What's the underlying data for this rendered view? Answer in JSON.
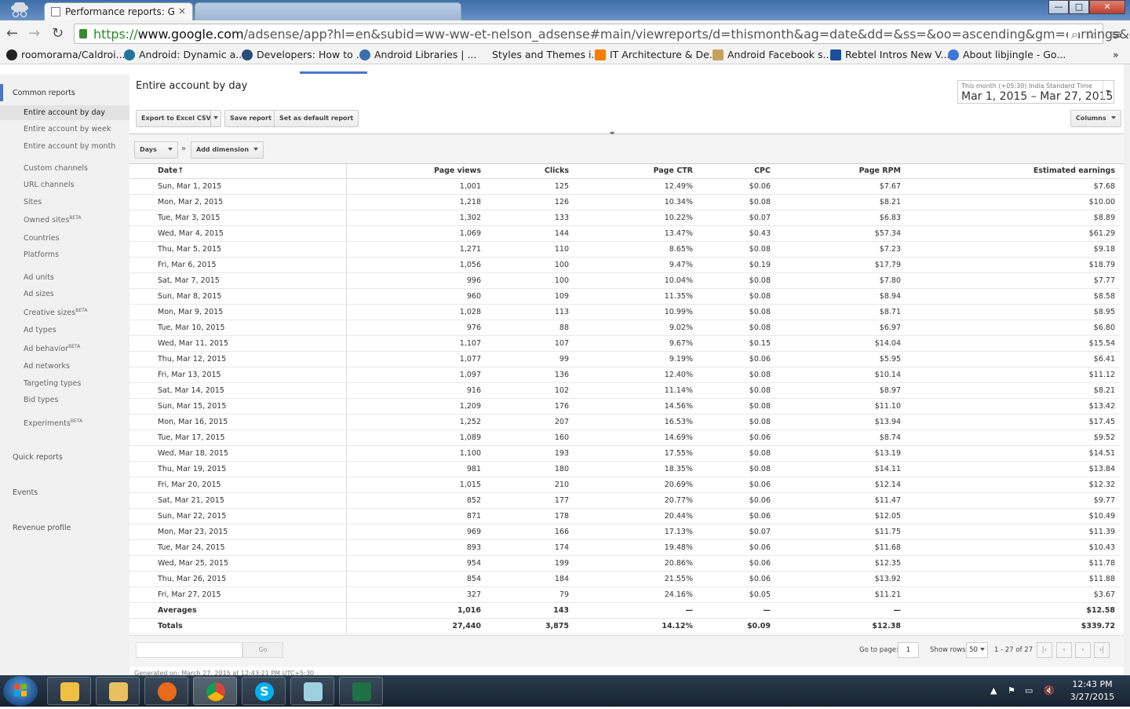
{
  "browser": {
    "active_tab_title": "Performance reports: Goo",
    "url_scheme": "https://",
    "url_host": "www.google.com",
    "url_path": "/adsense/app?hl=en&subid=ww-ww-et-nelson_adsense#main/viewreports/d=thismonth&ag=date&dd=&ss=&oo=ascending&gm=earnings&co=d&",
    "tab_close": "×",
    "win_min": "—",
    "win_max": "□",
    "win_close": "✕"
  },
  "bookmarks": [
    {
      "label": "roomorama/Caldroi...",
      "color": "#222222"
    },
    {
      "label": "Android: Dynamic a...",
      "color": "#21759b"
    },
    {
      "label": "Developers: How to ...",
      "color": "#2a4d7a"
    },
    {
      "label": "Android Libraries | ...",
      "color": "#3a6fb0"
    },
    {
      "label": "Styles and Themes i...",
      "color": "#f3f3f3"
    },
    {
      "label": "IT Architecture & De...",
      "color": "#f57d00"
    },
    {
      "label": "Android Facebook s...",
      "color": "#c8a060"
    },
    {
      "label": "Rebtel Intros New V...",
      "color": "#1a4f9a"
    },
    {
      "label": "About libjingle - Go...",
      "color": "#3c78d8"
    }
  ],
  "bookmarks_more": "»",
  "sidebar": {
    "heading_common": "Common reports",
    "common": [
      "Entire account by day",
      "Entire account by week",
      "Entire account by month"
    ],
    "group2": [
      {
        "label": "Custom channels",
        "sup": ""
      },
      {
        "label": "URL channels",
        "sup": ""
      },
      {
        "label": "Sites",
        "sup": ""
      },
      {
        "label": "Owned sites",
        "sup": "BETA"
      },
      {
        "label": "Countries",
        "sup": ""
      },
      {
        "label": "Platforms",
        "sup": ""
      }
    ],
    "group3": [
      {
        "label": "Ad units",
        "sup": ""
      },
      {
        "label": "Ad sizes",
        "sup": ""
      },
      {
        "label": "Creative sizes",
        "sup": "BETA"
      },
      {
        "label": "Ad types",
        "sup": ""
      },
      {
        "label": "Ad behavior",
        "sup": "BETA"
      },
      {
        "label": "Ad networks",
        "sup": ""
      },
      {
        "label": "Targeting types",
        "sup": ""
      },
      {
        "label": "Bid types",
        "sup": ""
      }
    ],
    "experiments": {
      "label": "Experiments",
      "sup": "BETA"
    },
    "quick_reports": "Quick reports",
    "events": "Events",
    "revenue_profile": "Revenue profile"
  },
  "report": {
    "title": "Entire account by day",
    "export_label": "Export to Excel CSV",
    "save_label": "Save report",
    "default_label": "Set as default report",
    "columns_label": "Columns",
    "timezone_note": "This month (+05:30) India Standard Time",
    "date_range": "Mar 1, 2015 – Mar 27, 2015",
    "days_label": "Days",
    "chevron": "»",
    "add_dimension_label": "Add dimension",
    "columns": [
      "Date",
      "Page views",
      "Clicks",
      "Page CTR",
      "CPC",
      "Page RPM",
      "Estimated earnings"
    ],
    "sort_arrow": "↑",
    "rows": [
      [
        "Sun, Mar 1, 2015",
        "1,001",
        "125",
        "12.49%",
        "$0.06",
        "$7.67",
        "$7.68"
      ],
      [
        "Mon, Mar 2, 2015",
        "1,218",
        "126",
        "10.34%",
        "$0.08",
        "$8.21",
        "$10.00"
      ],
      [
        "Tue, Mar 3, 2015",
        "1,302",
        "133",
        "10.22%",
        "$0.07",
        "$6.83",
        "$8.89"
      ],
      [
        "Wed, Mar 4, 2015",
        "1,069",
        "144",
        "13.47%",
        "$0.43",
        "$57.34",
        "$61.29"
      ],
      [
        "Thu, Mar 5, 2015",
        "1,271",
        "110",
        "8.65%",
        "$0.08",
        "$7.23",
        "$9.18"
      ],
      [
        "Fri, Mar 6, 2015",
        "1,056",
        "100",
        "9.47%",
        "$0.19",
        "$17.79",
        "$18.79"
      ],
      [
        "Sat, Mar 7, 2015",
        "996",
        "100",
        "10.04%",
        "$0.08",
        "$7.80",
        "$7.77"
      ],
      [
        "Sun, Mar 8, 2015",
        "960",
        "109",
        "11.35%",
        "$0.08",
        "$8.94",
        "$8.58"
      ],
      [
        "Mon, Mar 9, 2015",
        "1,028",
        "113",
        "10.99%",
        "$0.08",
        "$8.71",
        "$8.95"
      ],
      [
        "Tue, Mar 10, 2015",
        "976",
        "88",
        "9.02%",
        "$0.08",
        "$6.97",
        "$6.80"
      ],
      [
        "Wed, Mar 11, 2015",
        "1,107",
        "107",
        "9.67%",
        "$0.15",
        "$14.04",
        "$15.54"
      ],
      [
        "Thu, Mar 12, 2015",
        "1,077",
        "99",
        "9.19%",
        "$0.06",
        "$5.95",
        "$6.41"
      ],
      [
        "Fri, Mar 13, 2015",
        "1,097",
        "136",
        "12.40%",
        "$0.08",
        "$10.14",
        "$11.12"
      ],
      [
        "Sat, Mar 14, 2015",
        "916",
        "102",
        "11.14%",
        "$0.08",
        "$8.97",
        "$8.21"
      ],
      [
        "Sun, Mar 15, 2015",
        "1,209",
        "176",
        "14.56%",
        "$0.08",
        "$11.10",
        "$13.42"
      ],
      [
        "Mon, Mar 16, 2015",
        "1,252",
        "207",
        "16.53%",
        "$0.08",
        "$13.94",
        "$17.45"
      ],
      [
        "Tue, Mar 17, 2015",
        "1,089",
        "160",
        "14.69%",
        "$0.06",
        "$8.74",
        "$9.52"
      ],
      [
        "Wed, Mar 18, 2015",
        "1,100",
        "193",
        "17.55%",
        "$0.08",
        "$13.19",
        "$14.51"
      ],
      [
        "Thu, Mar 19, 2015",
        "981",
        "180",
        "18.35%",
        "$0.08",
        "$14.11",
        "$13.84"
      ],
      [
        "Fri, Mar 20, 2015",
        "1,015",
        "210",
        "20.69%",
        "$0.06",
        "$12.14",
        "$12.32"
      ],
      [
        "Sat, Mar 21, 2015",
        "852",
        "177",
        "20.77%",
        "$0.06",
        "$11.47",
        "$9.77"
      ],
      [
        "Sun, Mar 22, 2015",
        "871",
        "178",
        "20.44%",
        "$0.06",
        "$12.05",
        "$10.49"
      ],
      [
        "Mon, Mar 23, 2015",
        "969",
        "166",
        "17.13%",
        "$0.07",
        "$11.75",
        "$11.39"
      ],
      [
        "Tue, Mar 24, 2015",
        "893",
        "174",
        "19.48%",
        "$0.06",
        "$11.68",
        "$10.43"
      ],
      [
        "Wed, Mar 25, 2015",
        "954",
        "199",
        "20.86%",
        "$0.06",
        "$12.35",
        "$11.78"
      ],
      [
        "Thu, Mar 26, 2015",
        "854",
        "184",
        "21.55%",
        "$0.06",
        "$13.92",
        "$11.88"
      ],
      [
        "Fri, Mar 27, 2015",
        "327",
        "79",
        "24.16%",
        "$0.05",
        "$11.21",
        "$3.67"
      ]
    ],
    "averages": [
      "Averages",
      "1,016",
      "143",
      "—",
      "—",
      "—",
      "$12.58"
    ],
    "totals": [
      "Totals",
      "27,440",
      "3,875",
      "14.12%",
      "$0.09",
      "$12.38",
      "$339.72"
    ]
  },
  "pager": {
    "go_label": "Go",
    "go_to_page_label": "Go to page:",
    "page_value": "1",
    "show_rows_label": "Show rows:",
    "rows_value": "50",
    "range_text": "1 - 27 of 27"
  },
  "generated_note": "Generated on: March 27, 2015 at 12:43:21 PM UTC+5:30",
  "taskbar": {
    "time": "12:43 PM",
    "date": "3/27/2015"
  }
}
